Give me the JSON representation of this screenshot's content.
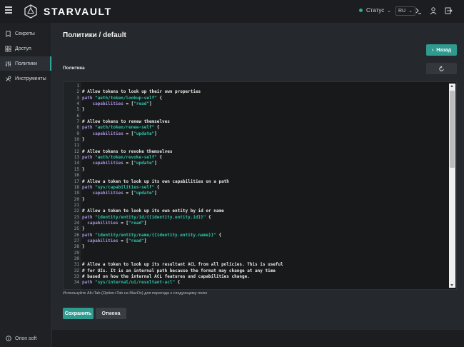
{
  "app": {
    "name": "STARVAULT"
  },
  "topbar": {
    "status_label": "Статус",
    "language": "RU",
    "status_color": "#2bb673"
  },
  "sidebar": {
    "items": [
      {
        "label": "Секреты",
        "icon": "bookmark-icon"
      },
      {
        "label": "Доступ",
        "icon": "grid-icon"
      },
      {
        "label": "Политики",
        "icon": "sliders-icon",
        "active": true
      },
      {
        "label": "Инструменты",
        "icon": "tools-icon"
      }
    ],
    "footer": "Orion soft"
  },
  "page": {
    "title": "Политики / default",
    "back_label": "Назад",
    "section_label": "Политика",
    "hint": "Используйте Alt+Tab (Option+Tab на MacOs) для перехода к следующему полю",
    "save_label": "Сохранить",
    "cancel_label": "Отмена",
    "accent_color": "#2f9a8e"
  },
  "editor": {
    "lines": [
      "",
      "# Allow tokens to look up their own properties",
      "path \"auth/token/lookup-self\" {",
      "    capabilities = [\"read\"]",
      "}",
      "",
      "# Allow tokens to renew themselves",
      "path \"auth/token/renew-self\" {",
      "    capabilities = [\"update\"]",
      "}",
      "",
      "# Allow tokens to revoke themselves",
      "path \"auth/token/revoke-self\" {",
      "    capabilities = [\"update\"]",
      "}",
      "",
      "# Allow a token to look up its own capabilities on a path",
      "path \"sys/capabilities-self\" {",
      "    capabilities = [\"update\"]",
      "}",
      "",
      "# Allow a token to look up its own entity by id or name",
      "path \"identity/entity/id/{{identity.entity.id}}\" {",
      "  capabilities = [\"read\"]",
      "}",
      "path \"identity/entity/name/{{identity.entity.name}}\" {",
      "  capabilities = [\"read\"]",
      "}",
      "",
      "",
      "# Allow a token to look up its resultant ACL from all policies. This is useful",
      "# for UIs. It is an internal path because the format may change at any time",
      "# based on how the internal ACL features and capabilities change.",
      "path \"sys/internal/ui/resultant-acl\" {"
    ]
  }
}
